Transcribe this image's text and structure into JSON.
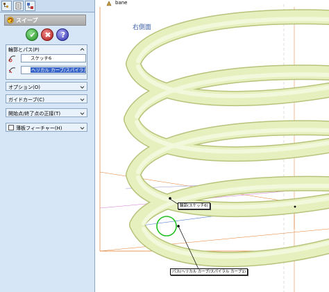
{
  "tree": {
    "node_label": "bane",
    "node_icon": "part-icon"
  },
  "panel": {
    "tabs": [
      {
        "name": "feature-manager-tab",
        "icon": "tree-icon"
      },
      {
        "name": "property-manager-tab",
        "icon": "properties-icon"
      },
      {
        "name": "configuration-manager-tab",
        "icon": "config-icon"
      }
    ],
    "title": "スイープ",
    "title_icon": "sweep-icon",
    "buttons": {
      "ok": "✔",
      "cancel": "✖",
      "help": "?"
    },
    "profile_group": {
      "label": "輪郭とパス(P)",
      "profile_value": "スケッチ6",
      "path_value": "ヘリカル カーブ/スパイラル カーブ1"
    },
    "options_label": "オプション(O)",
    "guide_label": "ガイドカーブ(C)",
    "tangent_label": "開始点/終了点の正接(T)",
    "thin_label": "薄板フィーチャー(H)"
  },
  "viewport": {
    "plane_label": "右側面",
    "callout_profile": "輪郭(スケッチ6)",
    "callout_path": "パス(ヘリカル カーブ/スパイラル カーブ1)"
  },
  "colors": {
    "panel_bg": "#d6e6f6",
    "spring": "#e6f0bf",
    "plane": "#e07a2a",
    "selection": "#3a66c9"
  }
}
